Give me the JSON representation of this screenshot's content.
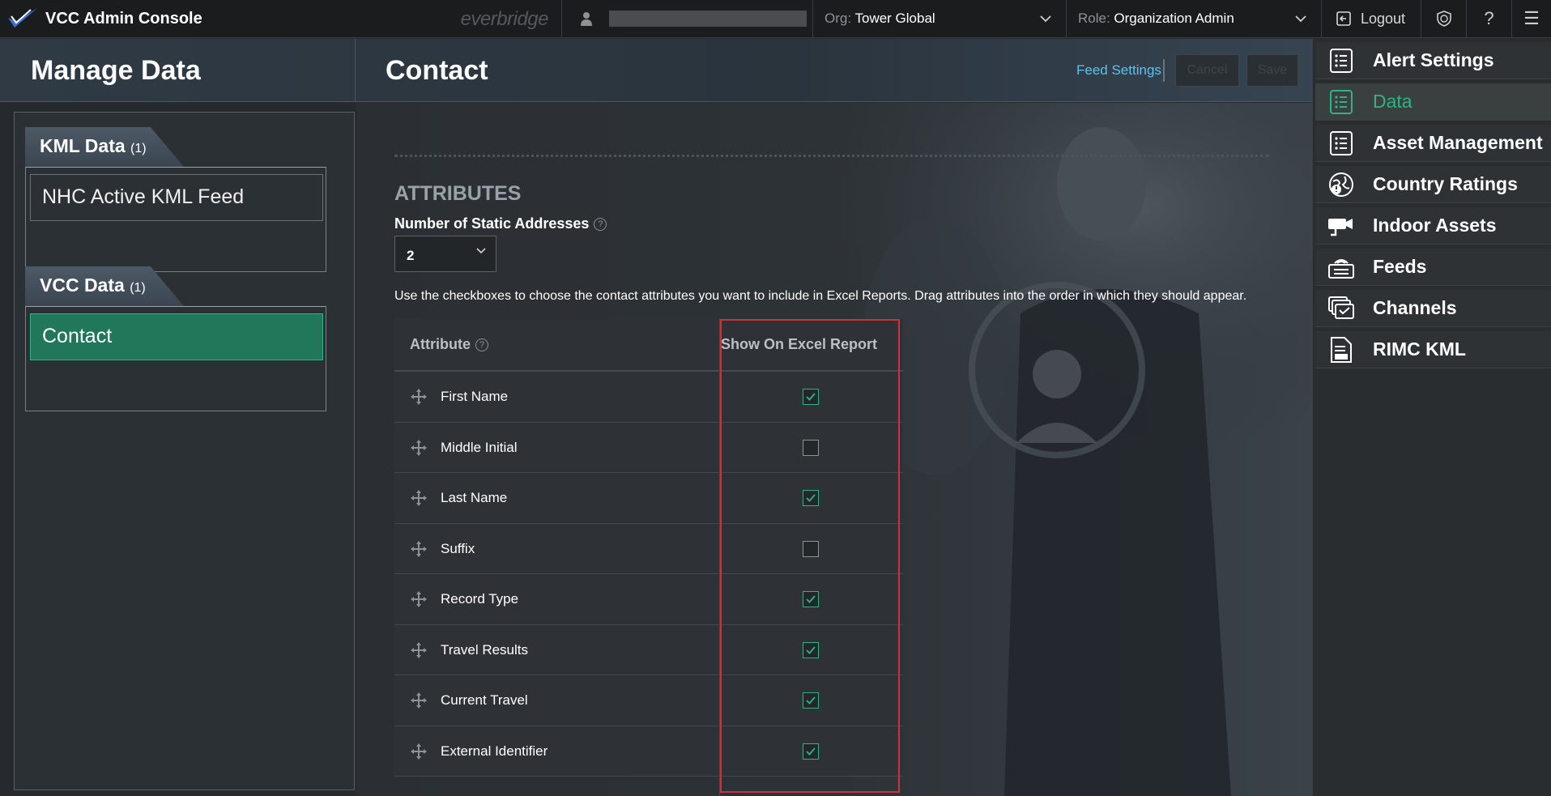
{
  "topbar": {
    "app_title": "VCC Admin Console",
    "brand": "everbridge",
    "org_label": "Org:",
    "org_value": "Tower Global",
    "role_label": "Role:",
    "role_value": "Organization Admin",
    "logout_label": "Logout",
    "help_glyph": "?",
    "menu_glyph": "☰"
  },
  "header": {
    "section_title": "Manage Data",
    "page_title": "Contact",
    "feed_settings_label": "Feed Settings",
    "cancel_label": "Cancel",
    "save_label": "Save"
  },
  "left": {
    "groups": [
      {
        "title": "KML Data",
        "count": "(1)",
        "items": [
          "NHC Active KML Feed"
        ]
      },
      {
        "title": "VCC Data",
        "count": "(1)",
        "items": [
          "Contact"
        ]
      }
    ]
  },
  "main": {
    "attributes_title": "ATTRIBUTES",
    "static_addresses_label": "Number of Static Addresses",
    "static_addresses_value": "2",
    "instructions": "Use the checkboxes to choose the contact attributes you want to include in Excel Reports. Drag attributes into the order in which they should appear.",
    "col_attribute": "Attribute",
    "col_show": "Show On Excel Report",
    "rows": [
      {
        "name": "First Name",
        "checked": true
      },
      {
        "name": "Middle Initial",
        "checked": false
      },
      {
        "name": "Last Name",
        "checked": true
      },
      {
        "name": "Suffix",
        "checked": false
      },
      {
        "name": "Record Type",
        "checked": true
      },
      {
        "name": "Travel Results",
        "checked": true
      },
      {
        "name": "Current Travel",
        "checked": true
      },
      {
        "name": "External Identifier",
        "checked": true
      }
    ]
  },
  "nav": {
    "items": [
      {
        "label": "Alert Settings",
        "icon": "list-icon",
        "active": false
      },
      {
        "label": "Data",
        "icon": "list-icon",
        "active": true
      },
      {
        "label": "Asset Management",
        "icon": "list-icon",
        "active": false
      },
      {
        "label": "Country Ratings",
        "icon": "globe-alert-icon",
        "active": false
      },
      {
        "label": "Indoor Assets",
        "icon": "camera-icon",
        "active": false
      },
      {
        "label": "Feeds",
        "icon": "feed-icon",
        "active": false
      },
      {
        "label": "Channels",
        "icon": "channels-icon",
        "active": false
      },
      {
        "label": "RIMC KML",
        "icon": "kml-file-icon",
        "active": false
      }
    ]
  },
  "colors": {
    "accent": "#2fb384",
    "active_item": "#20775a",
    "link": "#5ec2e8",
    "highlight": "#d0303c"
  }
}
